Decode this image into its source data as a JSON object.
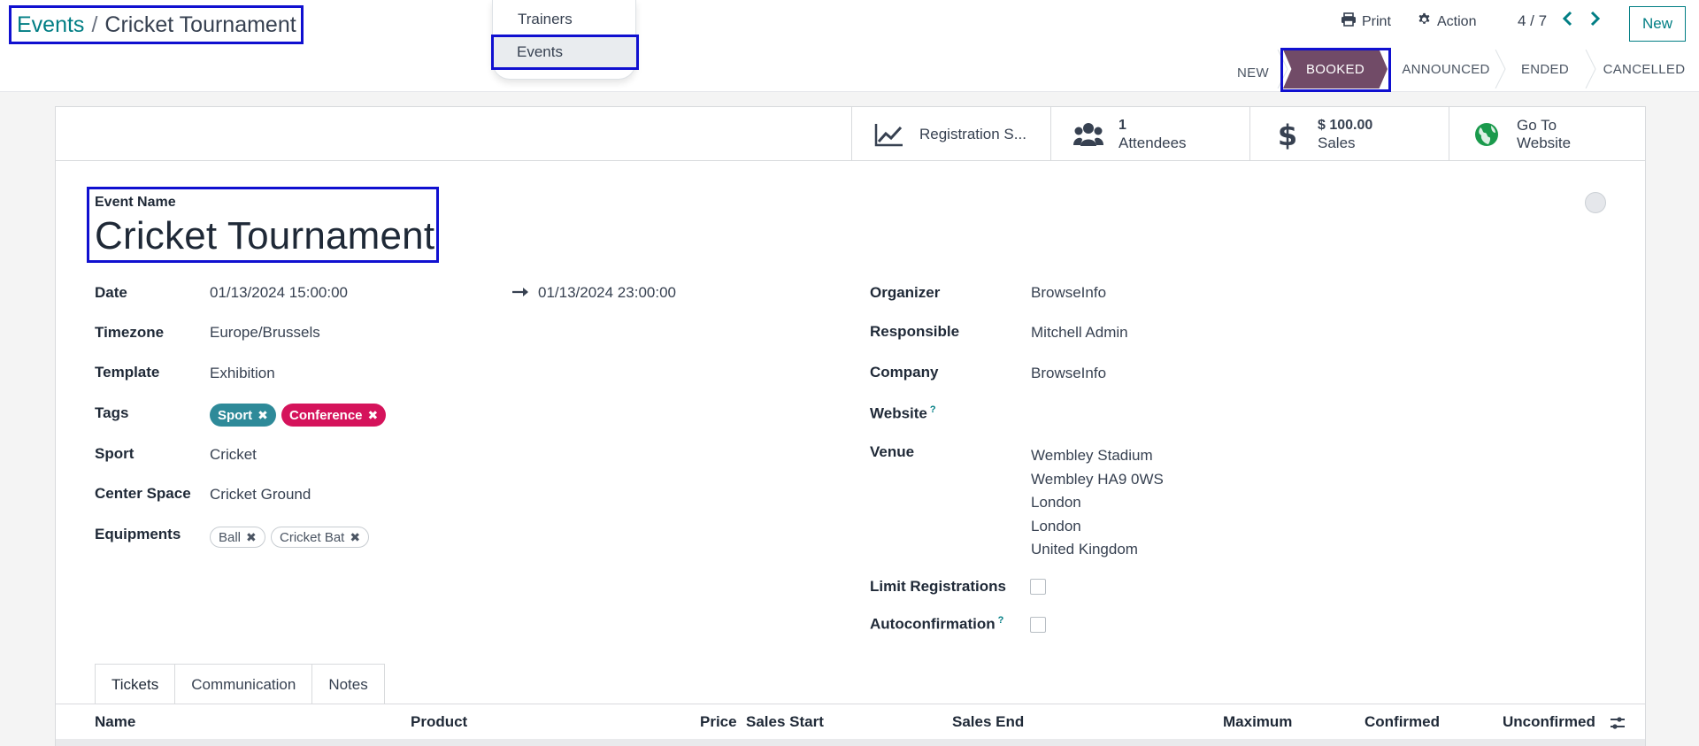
{
  "breadcrumb": {
    "root": "Events",
    "separator": "/",
    "current": "Cricket Tournament"
  },
  "menu_popup": {
    "items": [
      "Trainers",
      "Events"
    ],
    "selected": "Events"
  },
  "toolbar": {
    "print_label": "Print",
    "action_label": "Action",
    "pager": "4 / 7",
    "new_label": "New"
  },
  "statusbar": {
    "stages": [
      "NEW",
      "BOOKED",
      "ANNOUNCED",
      "ENDED",
      "CANCELLED"
    ],
    "active": "BOOKED",
    "active_color": "#714b67"
  },
  "smart_buttons": {
    "registration": {
      "label": "Registration S...",
      "icon": "line-chart-icon"
    },
    "attendees": {
      "value": "1",
      "label": "Attendees",
      "icon": "users-icon"
    },
    "sales": {
      "value": "$ 100.00",
      "label": "Sales",
      "icon": "dollar-icon"
    },
    "website": {
      "line1": "Go To",
      "line2": "Website",
      "icon": "globe-icon"
    }
  },
  "event": {
    "name_label": "Event Name",
    "name": "Cricket Tournament",
    "left_fields": {
      "date_label": "Date",
      "date_start": "01/13/2024 15:00:00",
      "date_end": "01/13/2024 23:00:00",
      "timezone_label": "Timezone",
      "timezone": "Europe/Brussels",
      "template_label": "Template",
      "template": "Exhibition",
      "tags_label": "Tags",
      "tags": [
        "Sport",
        "Conference"
      ],
      "sport_label": "Sport",
      "sport": "Cricket",
      "center_label": "Center Space",
      "center": "Cricket Ground",
      "equipments_label": "Equipments",
      "equipments": [
        "Ball",
        "Cricket Bat"
      ]
    },
    "right_fields": {
      "organizer_label": "Organizer",
      "organizer": "BrowseInfo",
      "responsible_label": "Responsible",
      "responsible": "Mitchell Admin",
      "company_label": "Company",
      "company": "BrowseInfo",
      "website_label": "Website",
      "website_help": "?",
      "venue_label": "Venue",
      "venue_lines": [
        "Wembley Stadium",
        "Wembley HA9 0WS",
        "London",
        "London",
        "United Kingdom"
      ],
      "limit_label": "Limit Registrations",
      "autoconfirm_label": "Autoconfirmation",
      "autoconfirm_help": "?"
    }
  },
  "tabs": {
    "items": [
      "Tickets",
      "Communication",
      "Notes"
    ],
    "active": "Tickets"
  },
  "tickets_table": {
    "columns": [
      "Name",
      "Product",
      "Price",
      "Sales Start",
      "Sales End",
      "Maximum",
      "Confirmed",
      "Unconfirmed"
    ]
  },
  "colors": {
    "accent": "#017e84",
    "brand": "#714b67",
    "tag_sport": "#2e8a99",
    "tag_conference": "#d5135b",
    "highlight_frame": "#1010d0"
  }
}
